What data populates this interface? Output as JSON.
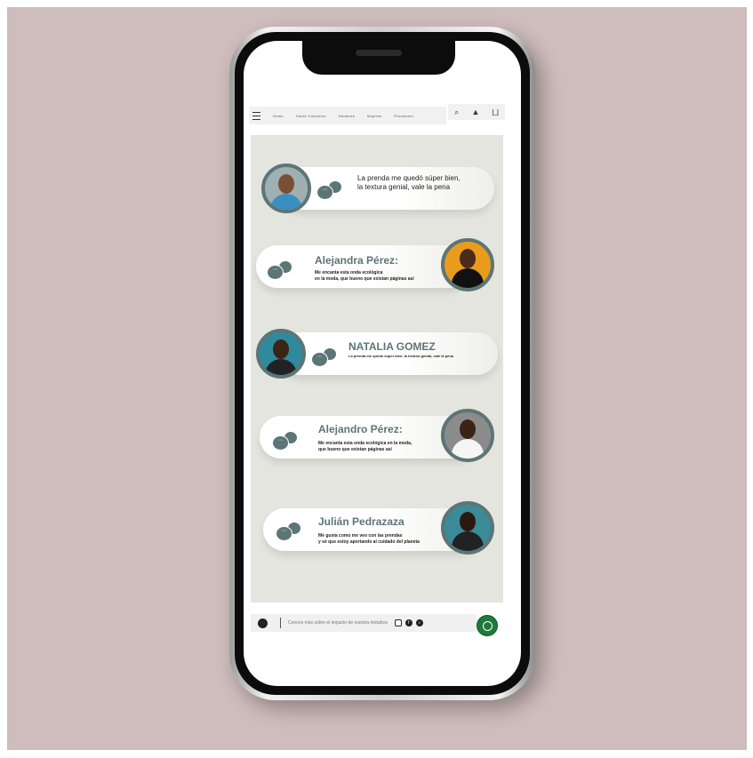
{
  "nav": {
    "links": [
      "Home",
      "Sobre Coleccion",
      "Hombres",
      "Mujeres",
      "Promocion"
    ],
    "icons": [
      "search-icon",
      "user-icon",
      "cart-icon"
    ]
  },
  "testimonials": [
    {
      "name": "",
      "text": "La prenda me quedó súper bien,\nla textura genial, vale la pena"
    },
    {
      "name": "Alejandra Pérez:",
      "text": "Me encanta esta onda ecológica\nen la moda, que bueno que existan páginas así"
    },
    {
      "name": "NATALIA GOMEZ",
      "text": "La prenda me quedó súper bien, la textura genial, vale la pena"
    },
    {
      "name": "Alejandro Pérez:",
      "text": "Me encanta esta onda ecológica en la moda,\nque bueno que existan páginas así"
    },
    {
      "name": "Julián Pedrazaza",
      "text": "Me gusta como me veo con las prendas\ny sé que estoy aportando al cuidado del planeta"
    }
  ],
  "footer": {
    "text": "Conoce más sobre el impacto de nuestra iniciativa",
    "social": [
      "instagram-icon",
      "facebook-icon",
      "tiktok-icon"
    ],
    "whatsapp": "whatsapp-icon"
  },
  "colors": {
    "background": "#cfbcbc",
    "accent": "#5c7577",
    "panel": "#e5e5df",
    "whatsapp": "#1e7a3a"
  }
}
